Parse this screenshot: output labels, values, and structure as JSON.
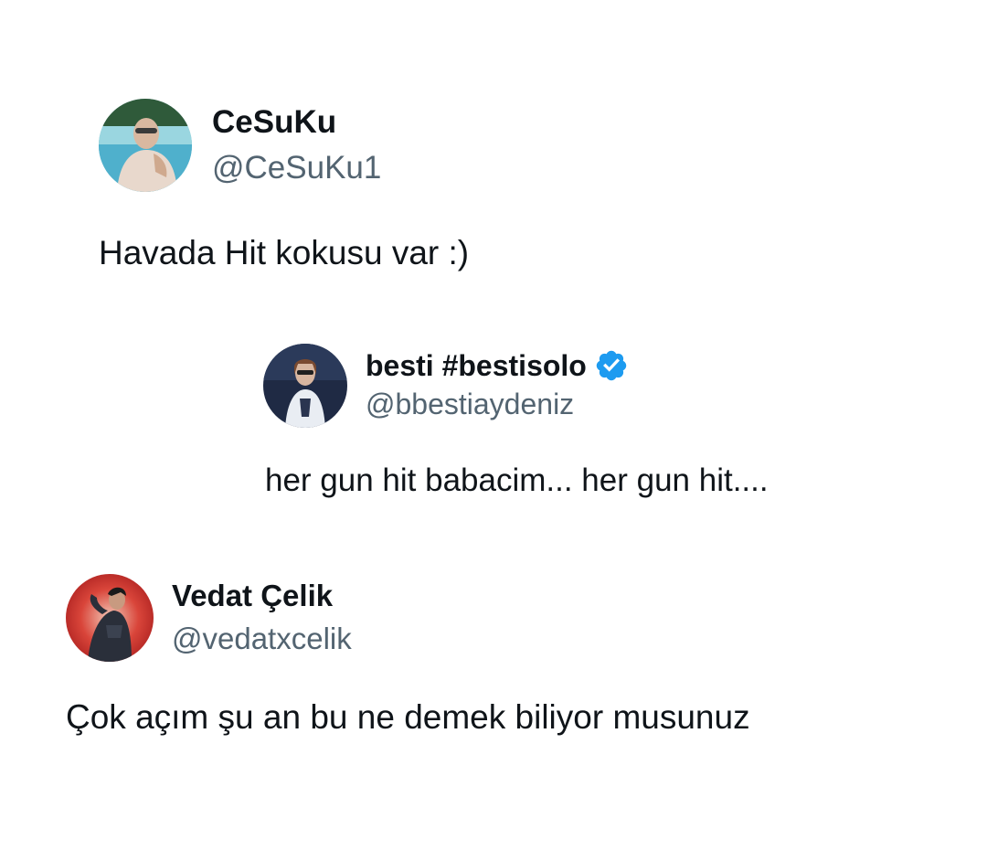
{
  "tweets": [
    {
      "display_name": "CeSuKu",
      "handle": "@CeSuKu1",
      "text": "Havada Hit kokusu var :)",
      "verified": false,
      "avatar_icon": "user-avatar-pool-photo"
    },
    {
      "display_name": "besti #bestisolo",
      "handle": "@bbestiaydeniz",
      "text": "her gun hit babacim... her gun hit....",
      "verified": true,
      "verified_color": "#1d9bf0",
      "avatar_icon": "user-avatar-portrait-photo"
    },
    {
      "display_name": "Vedat Çelik",
      "handle": "@vedatxcelik",
      "text": "Çok açım şu an bu ne demek biliyor musunuz",
      "verified": false,
      "avatar_icon": "user-avatar-red-photo"
    }
  ],
  "colors": {
    "name": "#0f1419",
    "handle": "#536471",
    "background": "#ffffff",
    "verified_badge": "#1d9bf0"
  }
}
